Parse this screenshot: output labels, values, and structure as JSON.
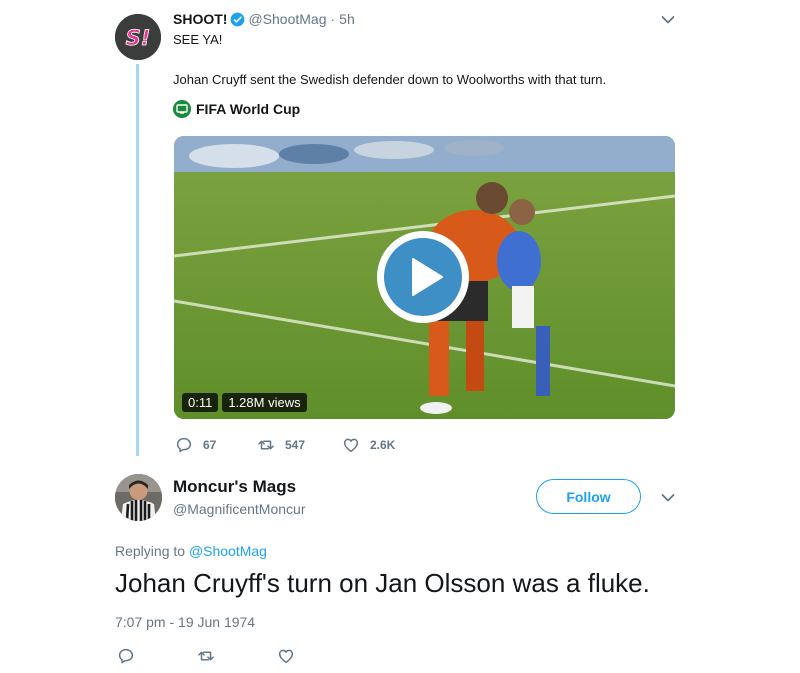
{
  "tweet1": {
    "avatar_text": "S!",
    "name": "SHOOT!",
    "handle": "@ShootMag",
    "separator": "·",
    "time": "5h",
    "text": "SEE YA!",
    "body": "Johan Cruyff sent the Swedish defender down to Woolworths with that turn.",
    "source": "FIFA World Cup",
    "video": {
      "duration": "0:11",
      "views": "1.28M views"
    },
    "actions": {
      "replies": "67",
      "retweets": "547",
      "likes": "2.6K"
    }
  },
  "tweet2": {
    "name": "Moncur's Mags",
    "handle": "@MagnificentMoncur",
    "follow_label": "Follow",
    "replying_prefix": "Replying to ",
    "replying_to": "@ShootMag",
    "text": "Johan Cruyff's turn on Jan Olsson was a fluke.",
    "timestamp": "7:07 pm - 19 Jun 1974"
  },
  "icons": {
    "verified": "verified-badge-icon",
    "more": "chevron-down-icon",
    "reply": "reply-icon",
    "retweet": "retweet-icon",
    "like": "heart-icon",
    "play": "play-icon"
  },
  "colors": {
    "accent": "#1da1f2",
    "thread_line": "#a7d7f2",
    "secondary_text": "#657786",
    "play_button": "#3f8fc7"
  }
}
